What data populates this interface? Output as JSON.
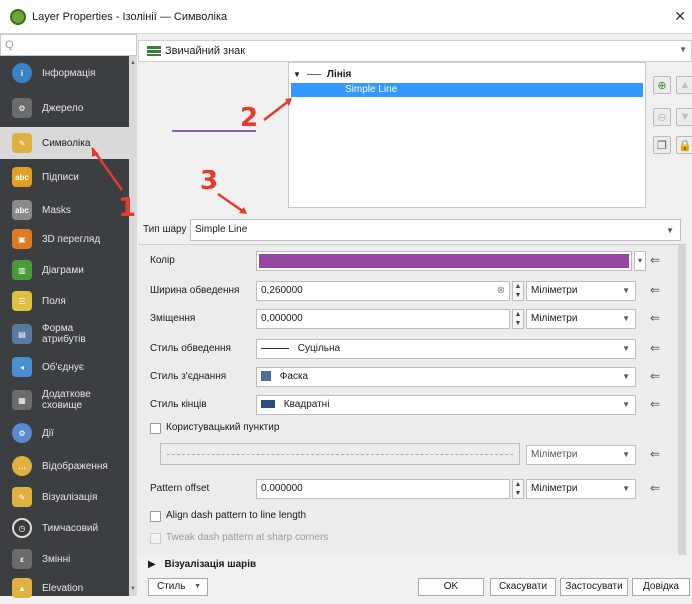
{
  "window": {
    "title": "Layer Properties - Ізолінії — Символіка",
    "close_glyph": "✕"
  },
  "sidebar": {
    "search_placeholder": "Q",
    "items": [
      {
        "label": "Інформація",
        "icon": "info-icon",
        "color": "#3b82c4"
      },
      {
        "label": "Джерело",
        "icon": "source-icon",
        "color": "#6b6b6b"
      },
      {
        "label": "Символіка",
        "icon": "symbology-brush-icon",
        "color": "#e0b040",
        "selected": true
      },
      {
        "label": "Підписи",
        "icon": "labels-abc-icon",
        "color": "#e0a020"
      },
      {
        "label": "Masks",
        "icon": "masks-abc-icon",
        "color": "#8a8a8a"
      },
      {
        "label": "3D перегляд",
        "icon": "3d-cube-icon",
        "color": "#e07a20"
      },
      {
        "label": "Діаграми",
        "icon": "diagram-icon",
        "color": "#4a9a3a"
      },
      {
        "label": "Поля",
        "icon": "fields-icon",
        "color": "#e0c040"
      },
      {
        "label": "Форма атрибутів",
        "icon": "attribute-form-icon",
        "color": "#5a7aa0"
      },
      {
        "label": "Об'єднує",
        "icon": "joins-icon",
        "color": "#4a90d0"
      },
      {
        "label": "Додаткове сховище",
        "icon": "auxiliary-storage-icon",
        "color": "#6b6b6b"
      },
      {
        "label": "Дії",
        "icon": "actions-gear-icon",
        "color": "#5a8ad0"
      },
      {
        "label": "Відображення",
        "icon": "display-bubble-icon",
        "color": "#e0b040"
      },
      {
        "label": "Візуалізація",
        "icon": "rendering-brush-icon",
        "color": "#e0b040"
      },
      {
        "label": "Тимчасовий",
        "icon": "temporal-clock-icon",
        "color": "#3a3a3a"
      },
      {
        "label": "Змінні",
        "icon": "variables-icon",
        "color": "#6b6b6b"
      },
      {
        "label": "Elevation",
        "icon": "elevation-icon",
        "color": "#e0b040"
      }
    ]
  },
  "symbol_type": {
    "value": "Звичайний знак"
  },
  "tree": {
    "root": "Лінія",
    "child": "Simple Line"
  },
  "annotations": {
    "one": "1",
    "two": "2",
    "three": "3"
  },
  "layer_type": {
    "label": "Тип шару",
    "value": "Simple Line"
  },
  "props": {
    "color_label": "Колір",
    "color_value": "#9448a3",
    "width_label": "Ширина обведення",
    "width_value": "0,260000",
    "width_unit": "Міліметри",
    "offset_label": "Зміщення",
    "offset_value": "0,000000",
    "offset_unit": "Міліметри",
    "stroke_style_label": "Стиль обведення",
    "stroke_style_value": "Суцільна",
    "join_style_label": "Стиль з'єднання",
    "join_style_value": "Фаска",
    "cap_style_label": "Стиль кінців",
    "cap_style_value": "Квадратні",
    "custom_dash_label": "Користувацький пунктир",
    "custom_dash_unit": "Міліметри",
    "pattern_offset_label": "Pattern offset",
    "pattern_offset_value": "0,000000",
    "pattern_offset_unit": "Міліметри",
    "align_dash_label": "Align dash pattern to line length",
    "tweak_dash_label": "Tweak dash pattern at sharp corners"
  },
  "section": {
    "layer_rendering": "Візуалізація шарів"
  },
  "buttons": {
    "style": "Стиль",
    "ok": "OK",
    "cancel": "Скасувати",
    "apply": "Застосувати",
    "help": "Довідка"
  }
}
